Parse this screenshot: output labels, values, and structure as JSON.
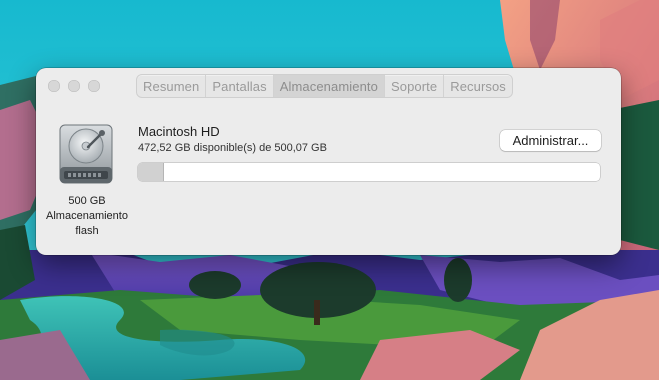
{
  "tabs": [
    {
      "label": "Resumen",
      "active": false
    },
    {
      "label": "Pantallas",
      "active": false
    },
    {
      "label": "Almacenamiento",
      "active": true
    },
    {
      "label": "Soporte",
      "active": false
    },
    {
      "label": "Recursos",
      "active": false
    }
  ],
  "disk": {
    "icon": "internal-hard-drive-icon",
    "caption_line1": "500 GB",
    "caption_line2": "Almacenamiento",
    "caption_line3": "flash",
    "name": "Macintosh HD",
    "availability": "472,52 GB disponible(s) de 500,07 GB",
    "used_fraction": 0.055
  },
  "manage_button": {
    "label": "Administrar..."
  },
  "colors": {
    "window_bg": "#ececec",
    "bar_used": "#d1d1d1",
    "bar_bg": "#ffffff"
  }
}
